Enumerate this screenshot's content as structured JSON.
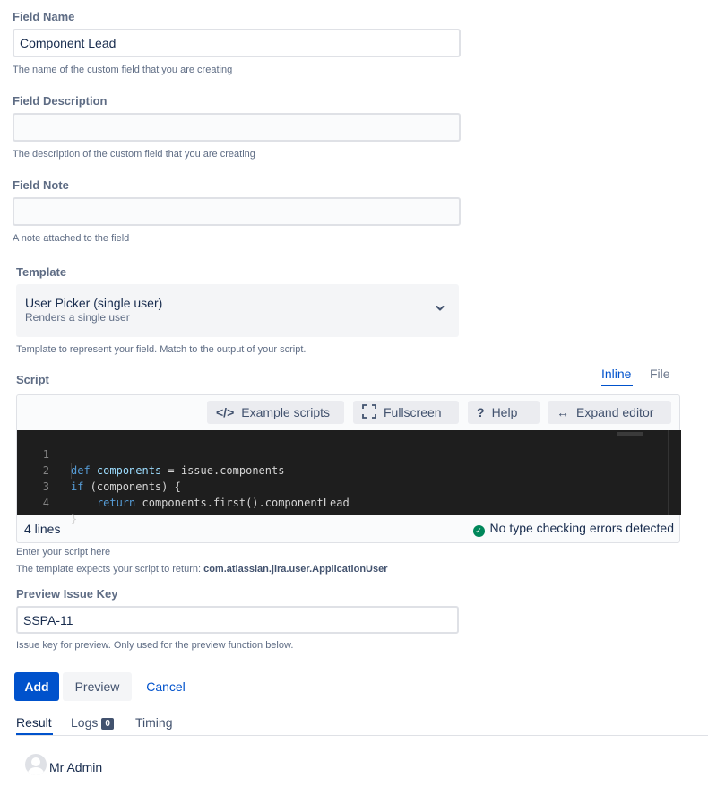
{
  "field_name": {
    "label": "Field Name",
    "value": "Component Lead",
    "help": "The name of the custom field that you are creating"
  },
  "field_description": {
    "label": "Field Description",
    "value": "",
    "help": "The description of the custom field that you are creating"
  },
  "field_note": {
    "label": "Field Note",
    "value": "",
    "help": "A note attached to the field"
  },
  "template": {
    "label": "Template",
    "selected_title": "User Picker (single user)",
    "selected_subtitle": "Renders a single user",
    "icon": "chevron-down-icon",
    "help": "Template to represent your field. Match to the output of your script."
  },
  "script": {
    "label": "Script",
    "tabs": [
      {
        "label": "Inline",
        "active": true
      },
      {
        "label": "File",
        "active": false
      }
    ],
    "toolbar": {
      "example_scripts": "Example scripts",
      "fullscreen": "Fullscreen",
      "help": "Help",
      "expand_editor": "Expand editor"
    },
    "code_lines": [
      {
        "number": "1",
        "text": "def components = issue.components"
      },
      {
        "number": "2",
        "text": "if (components) {"
      },
      {
        "number": "3",
        "text": "    return components.first().componentLead"
      },
      {
        "number": "4",
        "text": "}"
      }
    ],
    "line_count": "4 lines",
    "status": "No type checking errors detected",
    "help": "Enter your script here",
    "return_hint_prefix": "The template expects your script to return: ",
    "return_type": "com.atlassian.jira.user.ApplicationUser"
  },
  "preview_issue_key": {
    "label": "Preview Issue Key",
    "value": "SSPA-11",
    "help": "Issue key for preview. Only used for the preview function below."
  },
  "actions": {
    "add": "Add",
    "preview": "Preview",
    "cancel": "Cancel"
  },
  "result_tabs": {
    "result": "Result",
    "logs": "Logs",
    "logs_count": "0",
    "timing": "Timing"
  },
  "result": {
    "user_name": "Mr Admin"
  },
  "colors": {
    "primary": "#0052cc",
    "success": "#00875a",
    "editor_bg": "#1e1e1e"
  }
}
